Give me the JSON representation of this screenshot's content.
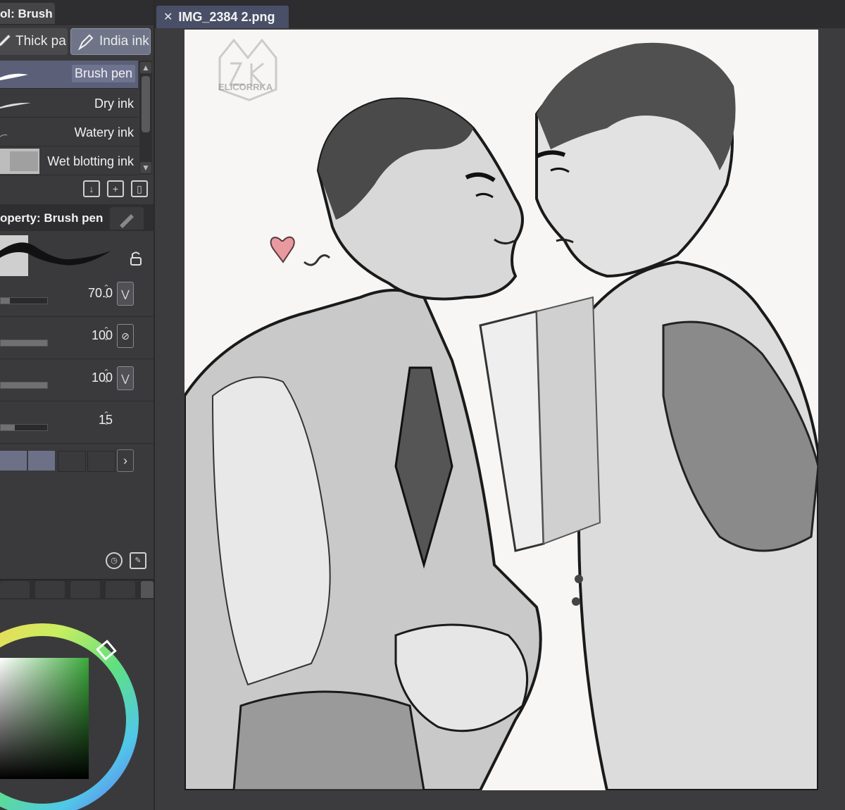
{
  "sub_tool_panel": {
    "title": "ol: Brush"
  },
  "tool_tabs": [
    {
      "label": "Thick pa"
    },
    {
      "label": "India ink"
    }
  ],
  "brushes": [
    {
      "label": "Brush pen",
      "selected": true
    },
    {
      "label": "Dry ink",
      "selected": false
    },
    {
      "label": "Watery ink",
      "selected": false
    },
    {
      "label": "Wet blotting ink",
      "selected": false
    }
  ],
  "property_panel": {
    "title": "operty: Brush pen"
  },
  "params": [
    {
      "value": "70.0",
      "fill": 0.2
    },
    {
      "value": "100",
      "fill": 1.0
    },
    {
      "value": "100",
      "fill": 1.0
    },
    {
      "value": "15",
      "fill": 0.3
    }
  ],
  "document": {
    "tab_label": "IMG_2384 2.png"
  },
  "artwork": {
    "watermark": "ELICORRKA"
  },
  "colors": {
    "accent_tab": "#6f7488",
    "doc_tab": "#4a4f68",
    "selected_color": "#3c9a3c"
  }
}
